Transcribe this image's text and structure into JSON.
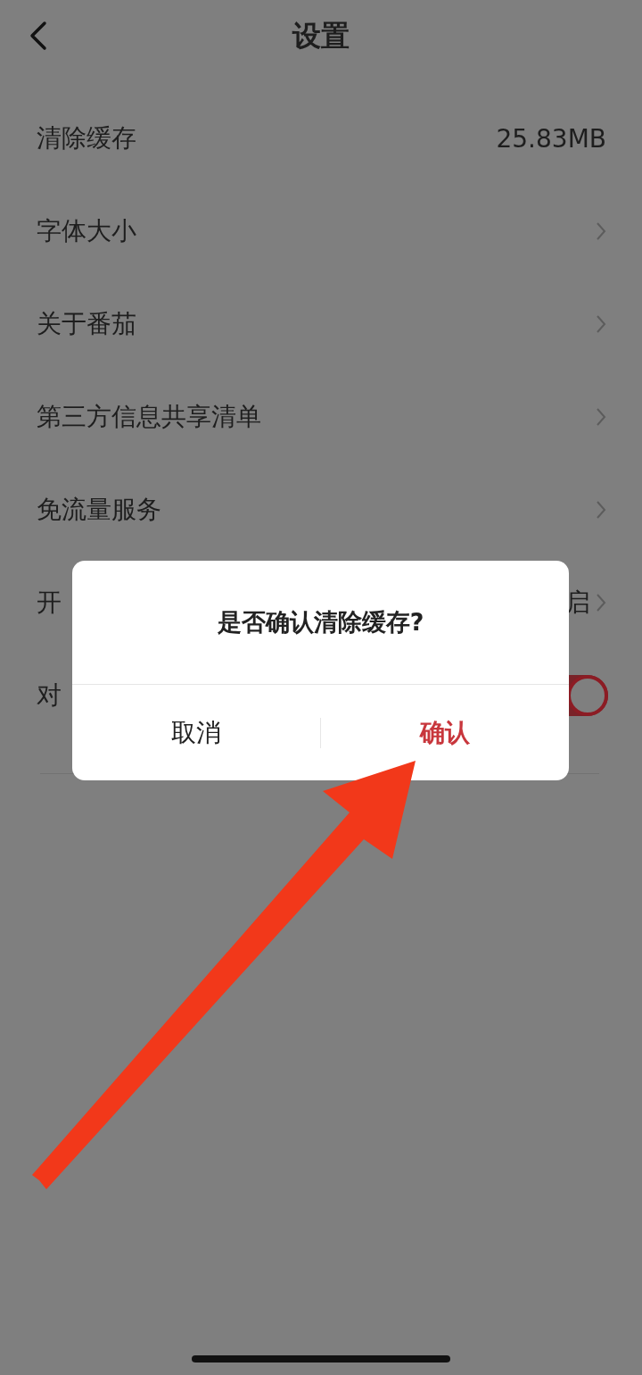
{
  "header": {
    "title": "设置"
  },
  "rows": [
    {
      "kind": "value",
      "label": "清除缓存",
      "value": "25.83MB"
    },
    {
      "kind": "link",
      "label": "字体大小"
    },
    {
      "kind": "link",
      "label": "关于番茄"
    },
    {
      "kind": "link",
      "label": "第三方信息共享清单"
    },
    {
      "kind": "link",
      "label": "免流量服务"
    },
    {
      "kind": "link",
      "label": "开",
      "value": "启"
    },
    {
      "kind": "toggle",
      "label": "对",
      "on": true
    }
  ],
  "dialog": {
    "title": "是否确认清除缓存?",
    "buttons": [
      {
        "kind": "cancel",
        "label": "取消"
      },
      {
        "kind": "confirm",
        "label": "确认"
      }
    ]
  }
}
